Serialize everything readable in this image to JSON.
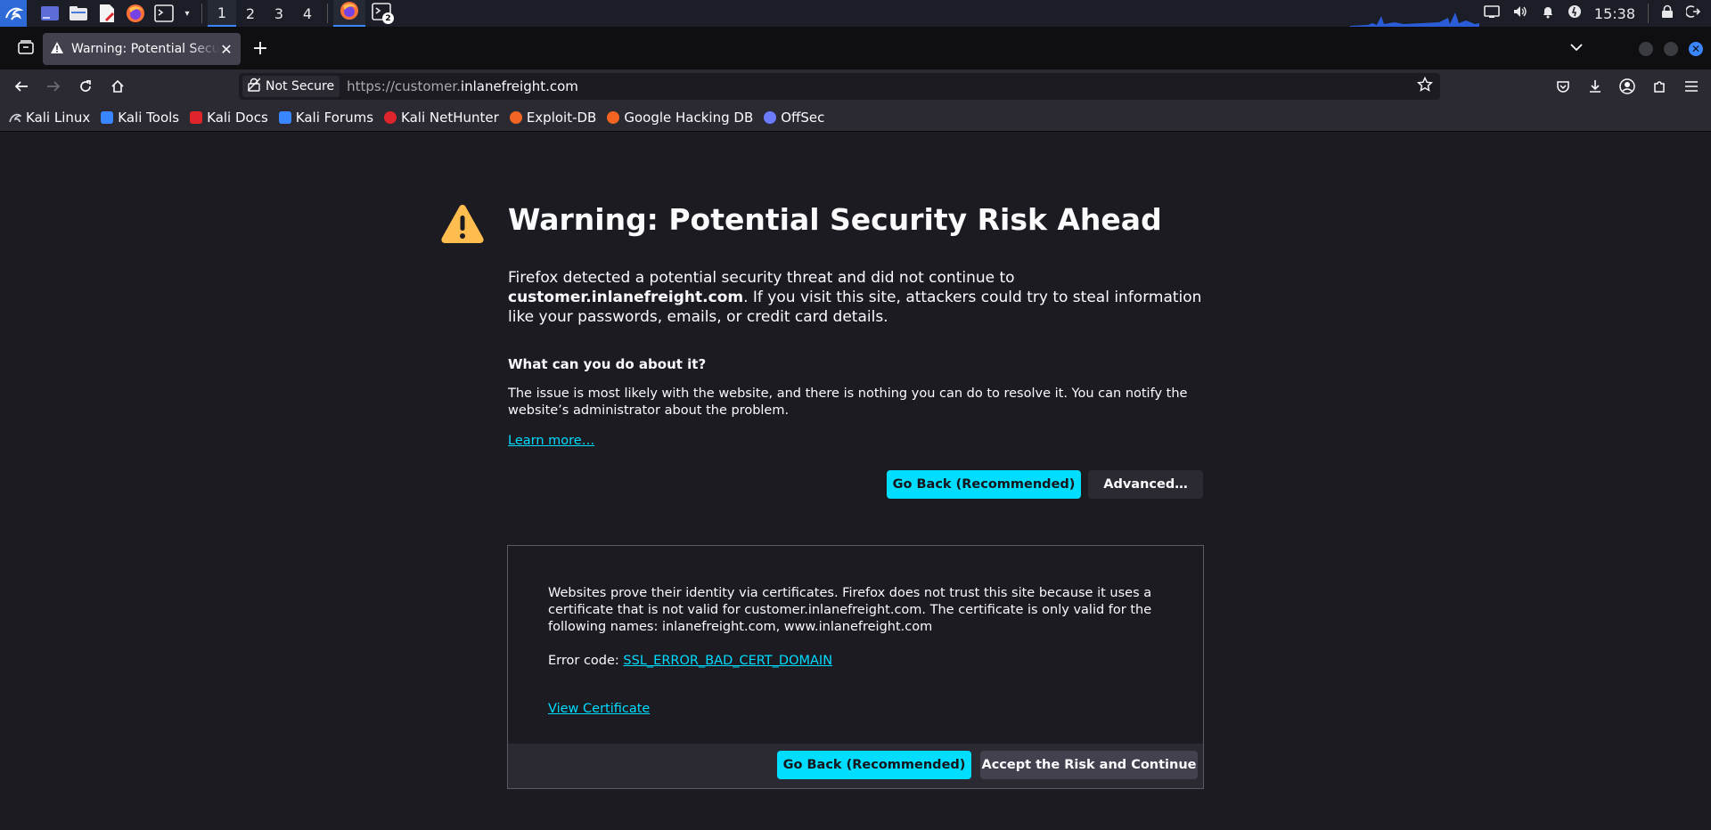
{
  "system_panel": {
    "workspaces": [
      "1",
      "2",
      "3",
      "4"
    ],
    "active_workspace": "1",
    "terminal_badge": "2",
    "clock": "15:38"
  },
  "browser": {
    "tab": {
      "title": "Warning: Potential Security Risk Ahead"
    },
    "urlbar": {
      "security_label": "Not Secure",
      "url_prefix": "https://customer.",
      "url_host": "inlanefreight.com"
    },
    "bookmarks": [
      {
        "label": "Kali Linux",
        "icon": "kali-dragon-icon",
        "color": "#cfd2d8"
      },
      {
        "label": "Kali Tools",
        "icon": "kali-tools-icon",
        "color": "#3a86ff"
      },
      {
        "label": "Kali Docs",
        "icon": "kali-docs-icon",
        "color": "#e0242b"
      },
      {
        "label": "Kali Forums",
        "icon": "kali-forums-icon",
        "color": "#3a86ff"
      },
      {
        "label": "Kali NetHunter",
        "icon": "nethunter-icon",
        "color": "#e0242b"
      },
      {
        "label": "Exploit-DB",
        "icon": "exploit-db-icon",
        "color": "#f26522"
      },
      {
        "label": "Google Hacking DB",
        "icon": "ghdb-icon",
        "color": "#f26522"
      },
      {
        "label": "OffSec",
        "icon": "offsec-icon",
        "color": "#6b7cff"
      }
    ]
  },
  "page": {
    "title": "Warning: Potential Security Risk Ahead",
    "intro_before": "Firefox detected a potential security threat and did not continue to ",
    "intro_host": "customer.inlanefreight.com",
    "intro_after": ". If you visit this site, attackers could try to steal information like your passwords, emails, or credit card details.",
    "subheading": "What can you do about it?",
    "paragraph": "The issue is most likely with the website, and there is nothing you can do to resolve it. You can notify the website’s administrator about the problem.",
    "learn_more": "Learn more…",
    "go_back_label": "Go Back (Recommended)",
    "advanced_label": "Advanced…",
    "advanced_panel": {
      "text": "Websites prove their identity via certificates. Firefox does not trust this site because it uses a certificate that is not valid for customer.inlanefreight.com. The certificate is only valid for the following names: inlanefreight.com, www.inlanefreight.com",
      "error_code_label": "Error code: ",
      "error_code": "SSL_ERROR_BAD_CERT_DOMAIN",
      "view_certificate": "View Certificate",
      "go_back_label": "Go Back (Recommended)",
      "accept_label": "Accept the Risk and Continue"
    }
  },
  "colors": {
    "accent": "#00ddff",
    "warning": "#ffbd4f",
    "background": "#1c1b22"
  }
}
